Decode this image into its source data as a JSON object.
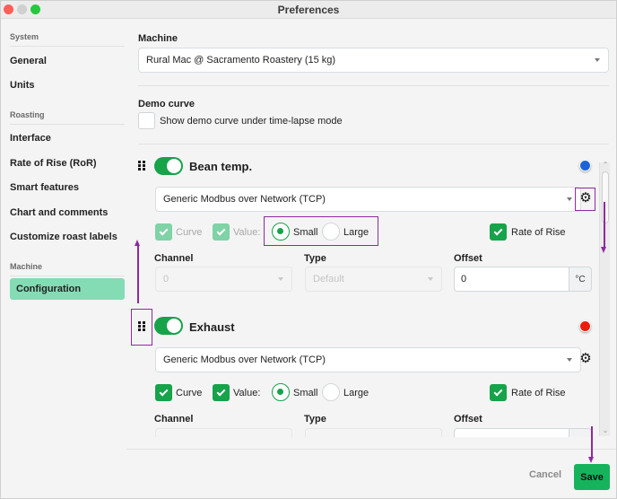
{
  "window": {
    "title": "Preferences"
  },
  "sidebar": {
    "sections": [
      {
        "label": "System"
      },
      {
        "label": "Roasting"
      },
      {
        "label": "Machine"
      }
    ],
    "items": [
      {
        "label": "General",
        "active": false
      },
      {
        "label": "Units",
        "active": false
      },
      {
        "label": "Interface",
        "active": false
      },
      {
        "label": "Rate of Rise (RoR)",
        "active": false
      },
      {
        "label": "Smart features",
        "active": false
      },
      {
        "label": "Chart and comments",
        "active": false
      },
      {
        "label": "Customize roast labels",
        "active": false
      },
      {
        "label": "Configuration",
        "active": true
      }
    ],
    "active_color": "#84dcb4"
  },
  "machine": {
    "label": "Machine",
    "selected": "Rural Mac @ Sacramento Roastery (15 kg)"
  },
  "demo_curve": {
    "label": "Demo curve",
    "checkbox_label": "Show demo curve under time-lapse mode",
    "checked": false
  },
  "sensors": [
    {
      "name": "Bean temp.",
      "enabled": true,
      "color": "#1d63d8",
      "color_name": "blue",
      "driver": "Generic Modbus over Network (TCP)",
      "curve_label": "Curve",
      "curve_checked": true,
      "value_label": "Value:",
      "value_checked": true,
      "options_disabled": true,
      "size_small_label": "Small",
      "size_large_label": "Large",
      "size_selected": "Small",
      "ror_label": "Rate of Rise",
      "ror_checked": true,
      "channel_label": "Channel",
      "channel_value": "0",
      "type_label": "Type",
      "type_value": "Default",
      "offset_label": "Offset",
      "offset_value": "0",
      "offset_unit": "°C"
    },
    {
      "name": "Exhaust",
      "enabled": true,
      "color": "#ee1c0c",
      "color_name": "red",
      "driver": "Generic Modbus over Network (TCP)",
      "curve_label": "Curve",
      "curve_checked": true,
      "value_label": "Value:",
      "value_checked": true,
      "options_disabled": false,
      "size_small_label": "Small",
      "size_large_label": "Large",
      "size_selected": "Small",
      "ror_label": "Rate of Rise",
      "ror_checked": true,
      "channel_label": "Channel",
      "type_label": "Type",
      "offset_label": "Offset"
    }
  ],
  "icons": {
    "gear": "⚙",
    "drag_handle": "drag-handle-icon",
    "scroll_up": "⌃",
    "scroll_down": "⌄"
  },
  "footer": {
    "cancel_label": "Cancel",
    "save_label": "Save"
  },
  "colors": {
    "accent": "#16a34a",
    "save_button": "#16b35c",
    "annotation": "#8e2aa0"
  }
}
